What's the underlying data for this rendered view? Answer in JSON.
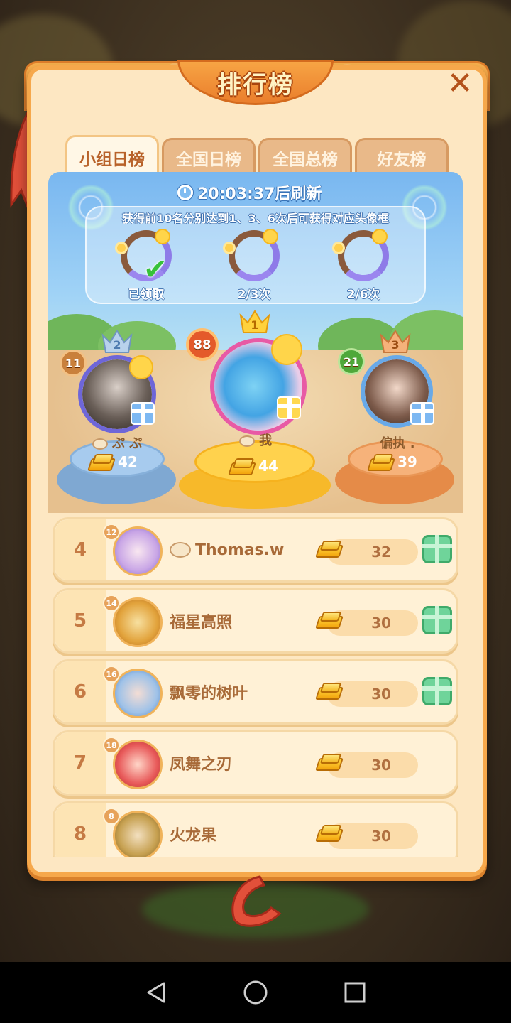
{
  "title": "排行榜",
  "close_label": "✕",
  "tabs": [
    {
      "label": "小组日榜",
      "active": true
    },
    {
      "label": "全国日榜",
      "active": false
    },
    {
      "label": "全国总榜",
      "active": false
    },
    {
      "label": "好友榜",
      "active": false
    }
  ],
  "refresh_text": "20:03:37后刷新",
  "reward_tip": "获得前10名分别达到1、3、6次后可获得对应头像框",
  "frames": [
    {
      "label": "已领取",
      "claimed": true
    },
    {
      "label": "2/3次",
      "claimed": false
    },
    {
      "label": "2/6次",
      "claimed": false
    }
  ],
  "podium": [
    {
      "rank": "2",
      "level": "11",
      "name": "ぷ ぷ",
      "score": "42"
    },
    {
      "rank": "1",
      "level": "88",
      "name": "我",
      "score": "44"
    },
    {
      "rank": "3",
      "level": "21",
      "name": "偏执 .",
      "score": "39"
    }
  ],
  "rows": [
    {
      "rank": "4",
      "level": "12",
      "name": "Thomas.w",
      "score": "32",
      "has_gift": true,
      "has_badge": true
    },
    {
      "rank": "5",
      "level": "14",
      "name": "福星高照",
      "score": "30",
      "has_gift": true,
      "has_badge": false
    },
    {
      "rank": "6",
      "level": "16",
      "name": "飘零的树叶",
      "score": "30",
      "has_gift": true,
      "has_badge": false
    },
    {
      "rank": "7",
      "level": "18",
      "name": "凤舞之刃",
      "score": "30",
      "has_gift": false,
      "has_badge": false
    },
    {
      "rank": "8",
      "level": "8",
      "name": "火龙果",
      "score": "30",
      "has_gift": false,
      "has_badge": false
    }
  ],
  "colors": {
    "panel": "#fde7c2",
    "accent_orange": "#f6a84b",
    "gold_podium": "#f7b92a",
    "silver_podium": "#8fb6dc",
    "bronze_podium": "#f0a160",
    "gift_green": "#6fd49a"
  },
  "icons": {
    "close": "close-icon",
    "clock": "clock-icon",
    "gold": "gold-bar-icon",
    "gift": "gift-icon",
    "crown": "crown-icon",
    "check": "check-icon",
    "nav_back": "back-triangle-icon",
    "nav_home": "home-circle-icon",
    "nav_recent": "recent-square-icon"
  }
}
